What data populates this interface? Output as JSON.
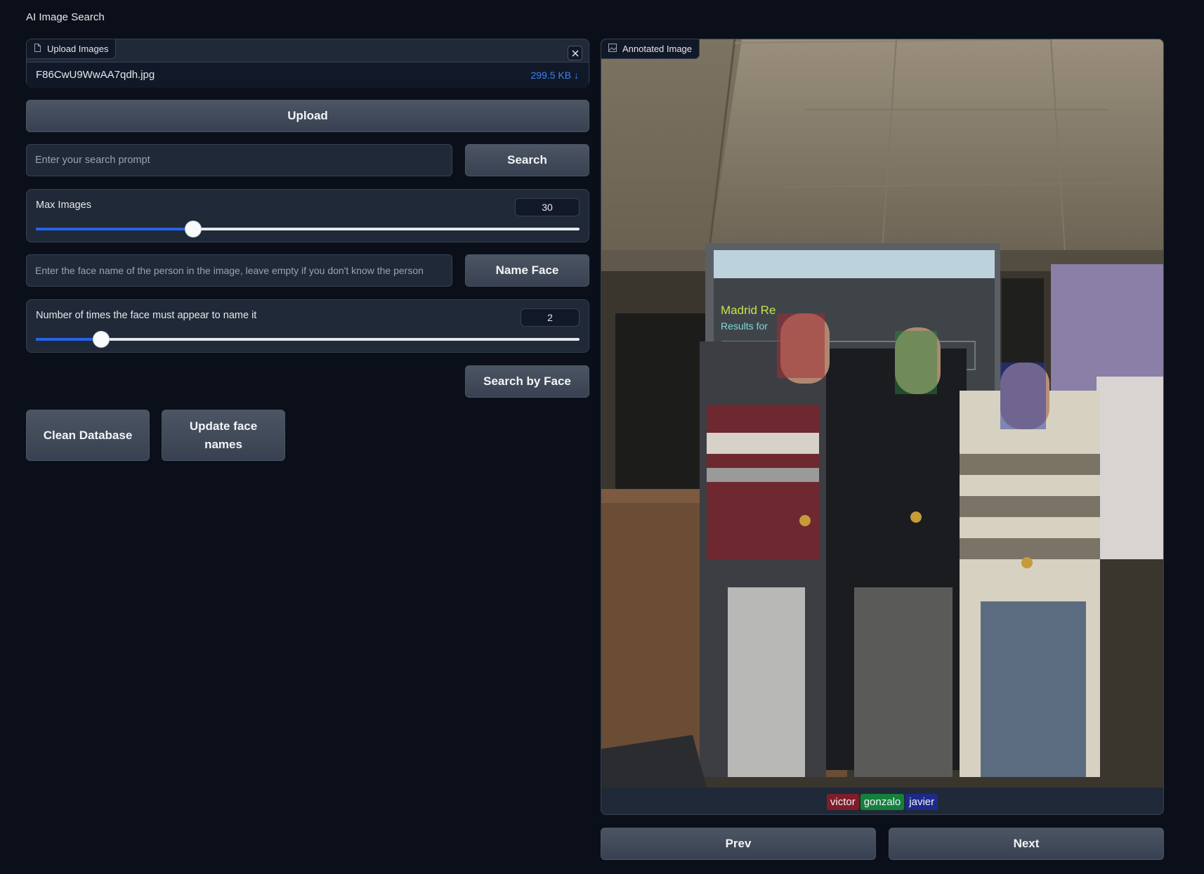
{
  "app": {
    "title": "AI Image Search"
  },
  "upload_panel": {
    "label": "Upload Images",
    "file_name": "F86CwU9WwAA7qdh.jpg",
    "file_size": "299.5 KB ↓"
  },
  "upload_button": "Upload",
  "search": {
    "placeholder": "Enter your search prompt",
    "button": "Search"
  },
  "max_images": {
    "label": "Max Images",
    "value": "30",
    "fraction": 0.29
  },
  "name_face": {
    "placeholder": "Enter the face name of the person in the image, leave empty if you don't know the person",
    "button": "Name Face"
  },
  "face_count": {
    "label": "Number of times the face must appear to name it",
    "value": "2",
    "fraction": 0.12
  },
  "search_by_face_button": "Search by Face",
  "clean_database_button": "Clean Database",
  "update_face_names_button": "Update face names",
  "annotated_image": {
    "label": "Annotated Image",
    "faces": [
      {
        "name": "victor",
        "color": "#7f1d2a"
      },
      {
        "name": "gonzalo",
        "color": "#15803d"
      },
      {
        "name": "javier",
        "color": "#1e2a8a"
      }
    ],
    "screen_text": {
      "heading": "Madrid Re",
      "subheading": "Results for"
    }
  },
  "nav": {
    "prev": "Prev",
    "next": "Next"
  },
  "icons": {
    "file": "file-icon",
    "close": "close-icon",
    "image": "image-icon"
  }
}
